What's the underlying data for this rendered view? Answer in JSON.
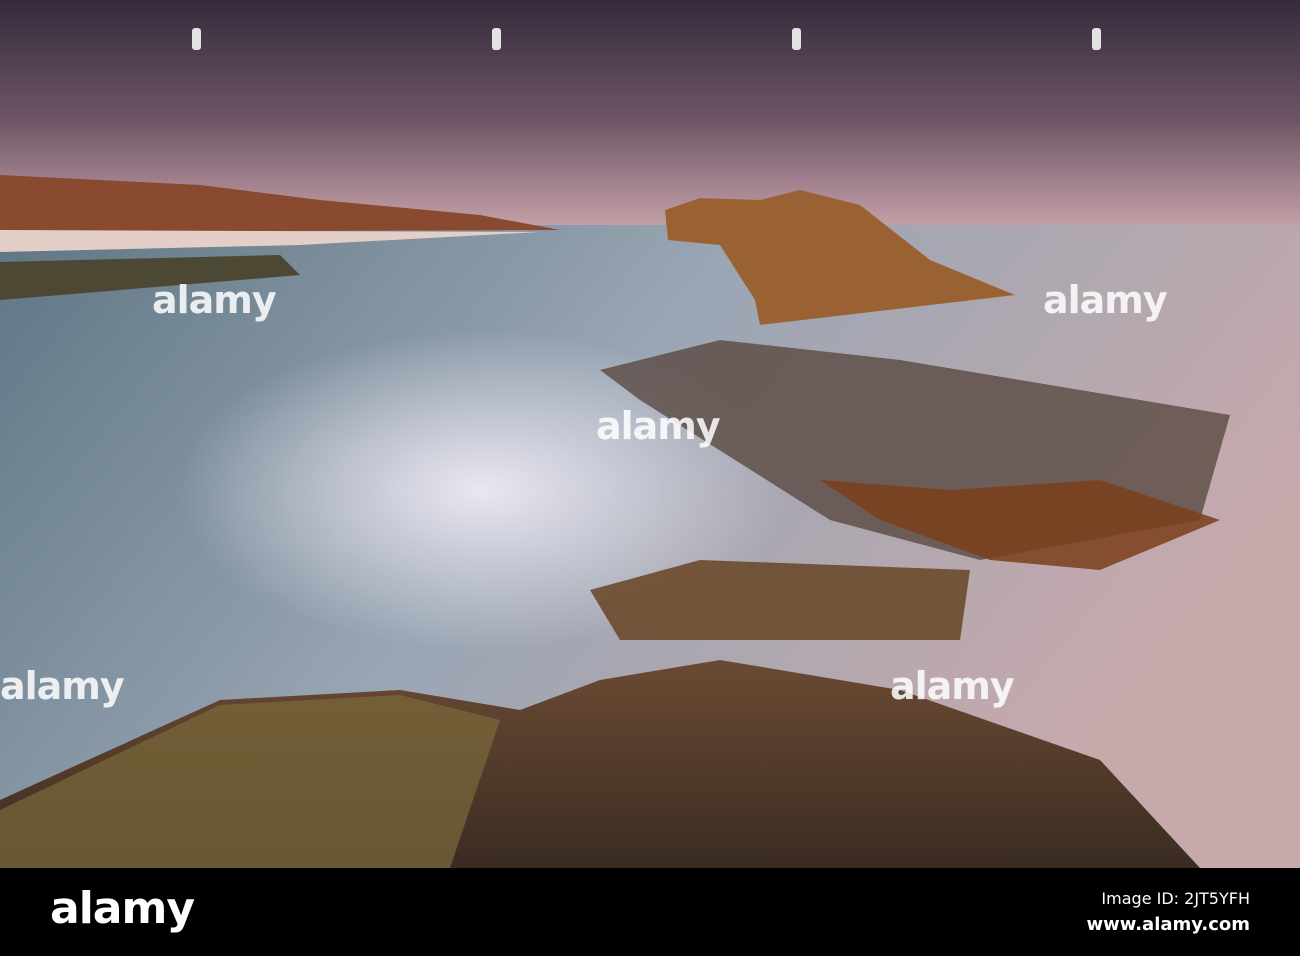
{
  "photo": {
    "subject": "long exposure coastal rock shelf at dusk",
    "colors": {
      "sky_top": "#3d3344",
      "sky_bottom": "#c9a3aa",
      "water": "#8a9aa6",
      "rock": "#8a5a2e",
      "foam": "#e8e6f0"
    }
  },
  "watermark": {
    "text": "alamy"
  },
  "footer": {
    "logo": "alamy",
    "image_id": "Image ID: 2JT5YFH",
    "site": "www.alamy.com"
  }
}
